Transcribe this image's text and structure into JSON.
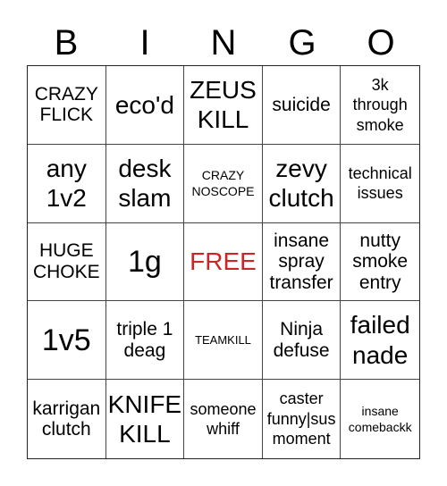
{
  "header": {
    "letters": [
      "B",
      "I",
      "N",
      "G",
      "O"
    ]
  },
  "free_color": "#c62828",
  "cells": [
    {
      "text": "CRAZY FLICK"
    },
    {
      "text": "eco'd"
    },
    {
      "text": "ZEUS KILL"
    },
    {
      "text": "suicide"
    },
    {
      "text": "3k through smoke"
    },
    {
      "text": "any 1v2"
    },
    {
      "text": "desk slam"
    },
    {
      "text": "CRAZY NOSCOPE"
    },
    {
      "text": "zevy clutch"
    },
    {
      "text": "technical issues"
    },
    {
      "text": "HUGE CHOKE"
    },
    {
      "text": "1g"
    },
    {
      "text": "FREE"
    },
    {
      "text": "insane spray transfer"
    },
    {
      "text": "nutty smoke entry"
    },
    {
      "text": "1v5"
    },
    {
      "text": "triple 1 deag"
    },
    {
      "text": "TEAMKILL"
    },
    {
      "text": "Ninja defuse"
    },
    {
      "text": "failed nade"
    },
    {
      "text": "karrigan clutch"
    },
    {
      "text": "KNIFE KILL"
    },
    {
      "text": "someone whiff"
    },
    {
      "text": "caster funny|sus moment"
    },
    {
      "text": "insane comebackk"
    }
  ]
}
